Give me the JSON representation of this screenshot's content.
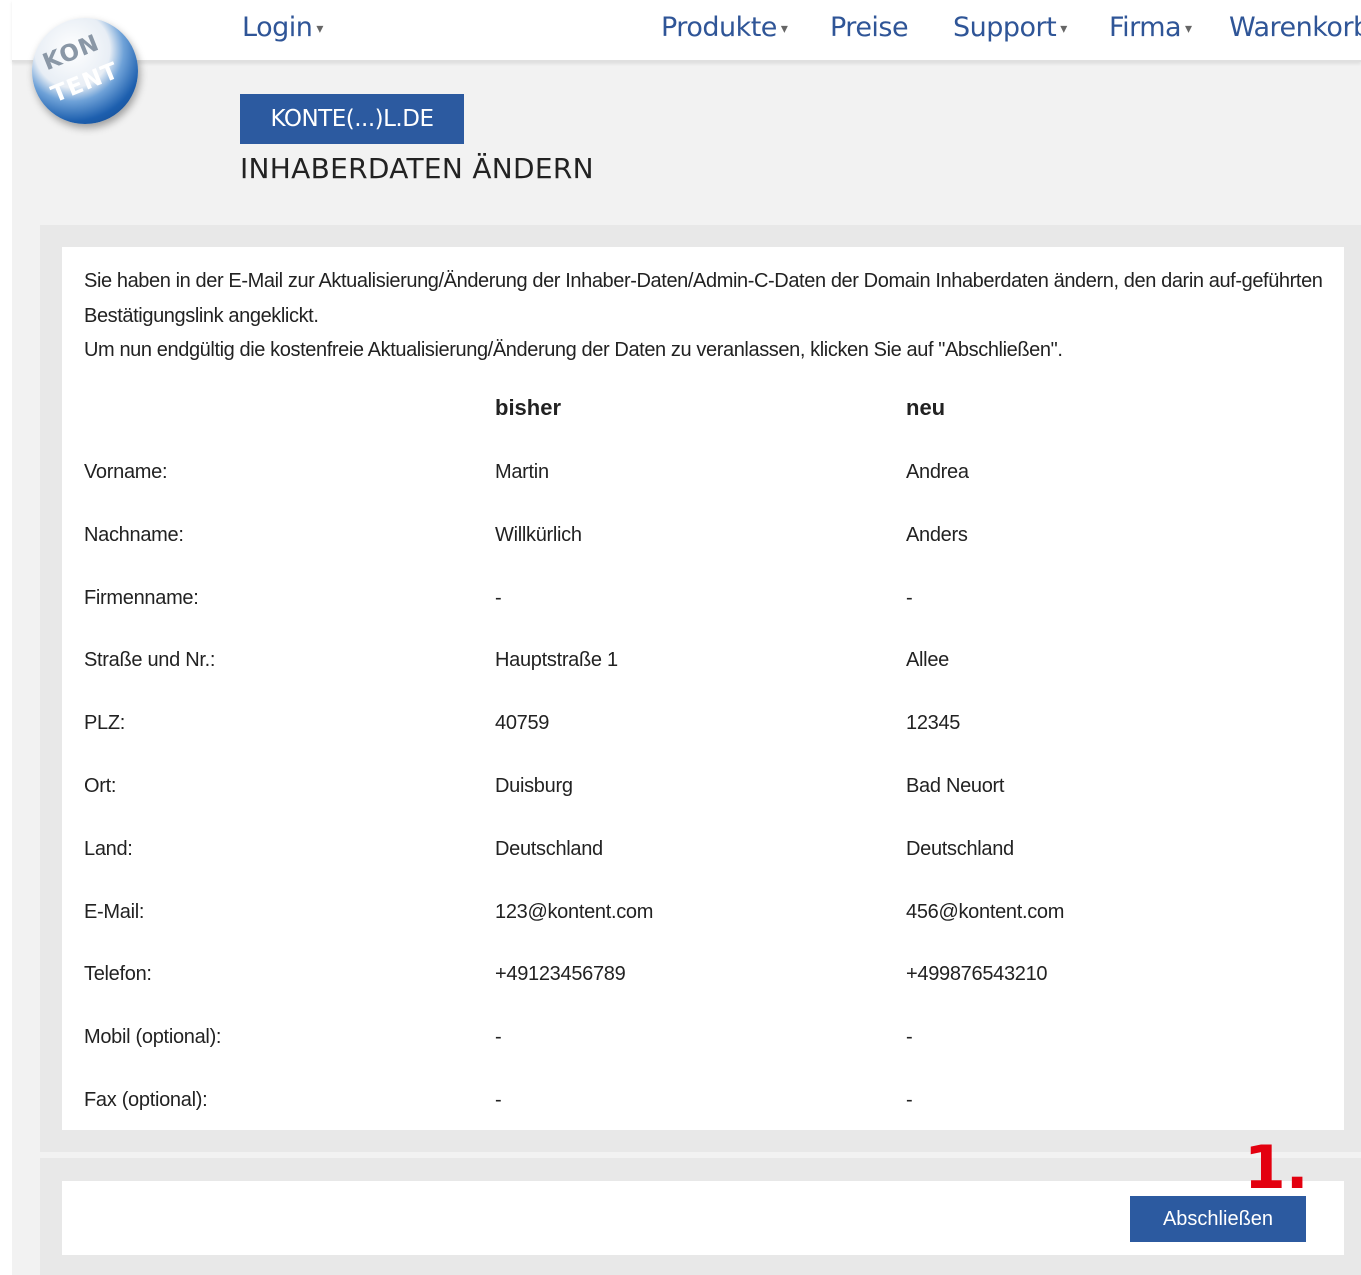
{
  "nav": {
    "logo_top": "KON",
    "logo_bottom": "TENT",
    "login": "Login",
    "produkte": "Produkte",
    "preise": "Preise",
    "support": "Support",
    "firma": "Firma",
    "warenkorb": "Warenkorb",
    "caret": "▾"
  },
  "header": {
    "domain": "KONTE(...)L.DE",
    "title": "INHABERDATEN ÄNDERN"
  },
  "intro": {
    "line1": "Sie haben in der E-Mail zur Aktualisierung/Änderung der Inhaber-Daten/Admin-C-Daten der Domain Inhaberdaten ändern, den darin auf-geführten Bestätigungslink angeklickt.",
    "line2": "Um nun endgültig die kostenfreie Aktualisierung/Änderung der Daten zu veranlassen, klicken Sie auf \"Abschließen\"."
  },
  "table": {
    "col_old": "bisher",
    "col_new": "neu",
    "rows": [
      {
        "label": "Vorname:",
        "old": "Martin",
        "new": "Andrea"
      },
      {
        "label": "Nachname:",
        "old": "Willkürlich",
        "new": "Anders"
      },
      {
        "label": "Firmenname:",
        "old": "-",
        "new": "-"
      },
      {
        "label": "Straße und Nr.:",
        "old": "Hauptstraße 1",
        "new": "Allee"
      },
      {
        "label": "PLZ:",
        "old": "40759",
        "new": "12345"
      },
      {
        "label": "Ort:",
        "old": "Duisburg",
        "new": "Bad Neuort"
      },
      {
        "label": "Land:",
        "old": "Deutschland",
        "new": "Deutschland"
      },
      {
        "label": "E-Mail:",
        "old": "123@kontent.com",
        "new": "456@kontent.com"
      },
      {
        "label": "Telefon:",
        "old": "+49123456789",
        "new": "+499876543210"
      },
      {
        "label": "Mobil (optional):",
        "old": "-",
        "new": "-"
      },
      {
        "label": "Fax (optional):",
        "old": "-",
        "new": "-"
      }
    ]
  },
  "footer": {
    "submit_label": "Abschließen",
    "step_marker": "1."
  },
  "colors": {
    "nav_link": "#2f5597",
    "button": "#2c5aa0",
    "marker": "#e3000f"
  }
}
